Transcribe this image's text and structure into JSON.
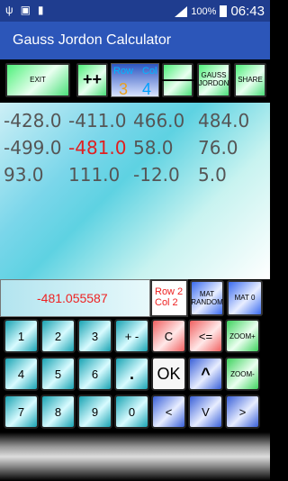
{
  "status_bar": {
    "battery": "100%",
    "time": "06:43"
  },
  "app": {
    "title": "Gauss Jordon Calculator"
  },
  "toolbar": {
    "exit": "EXIT",
    "plus": "++",
    "row_label": "Row",
    "col_label": "Col",
    "row_value": "3",
    "col_value": "4",
    "minus": "——",
    "gauss": "GAUSS JORDON",
    "share": "SHARE"
  },
  "matrix": [
    [
      "-428.0",
      "-411.0",
      "466.0",
      "484.0"
    ],
    [
      "-499.0",
      "-481.0",
      "58.0",
      "76.0"
    ],
    [
      "93.0",
      "111.0",
      "-12.0",
      "5.0"
    ]
  ],
  "highlighted_cell": "-481.0",
  "info": {
    "result": "-481.055587",
    "row": "Row 2",
    "col": "Col  2",
    "mat_random": "MAT RANDOM",
    "mat_zero": "MAT 0"
  },
  "keypad": {
    "row1": [
      "1",
      "2",
      "3",
      "+ -",
      "C",
      "<=",
      "ZOOM+"
    ],
    "row2": [
      "4",
      "5",
      "6",
      ".",
      "OK",
      "^",
      "ZOOM-"
    ],
    "row3": [
      "7",
      "8",
      "9",
      "0",
      "<",
      "V",
      ">"
    ]
  },
  "colors": {
    "accent": "#2c56b9",
    "highlight": "#e02020",
    "rowcol": "#00b6ff",
    "colval": "#00a0ff"
  }
}
